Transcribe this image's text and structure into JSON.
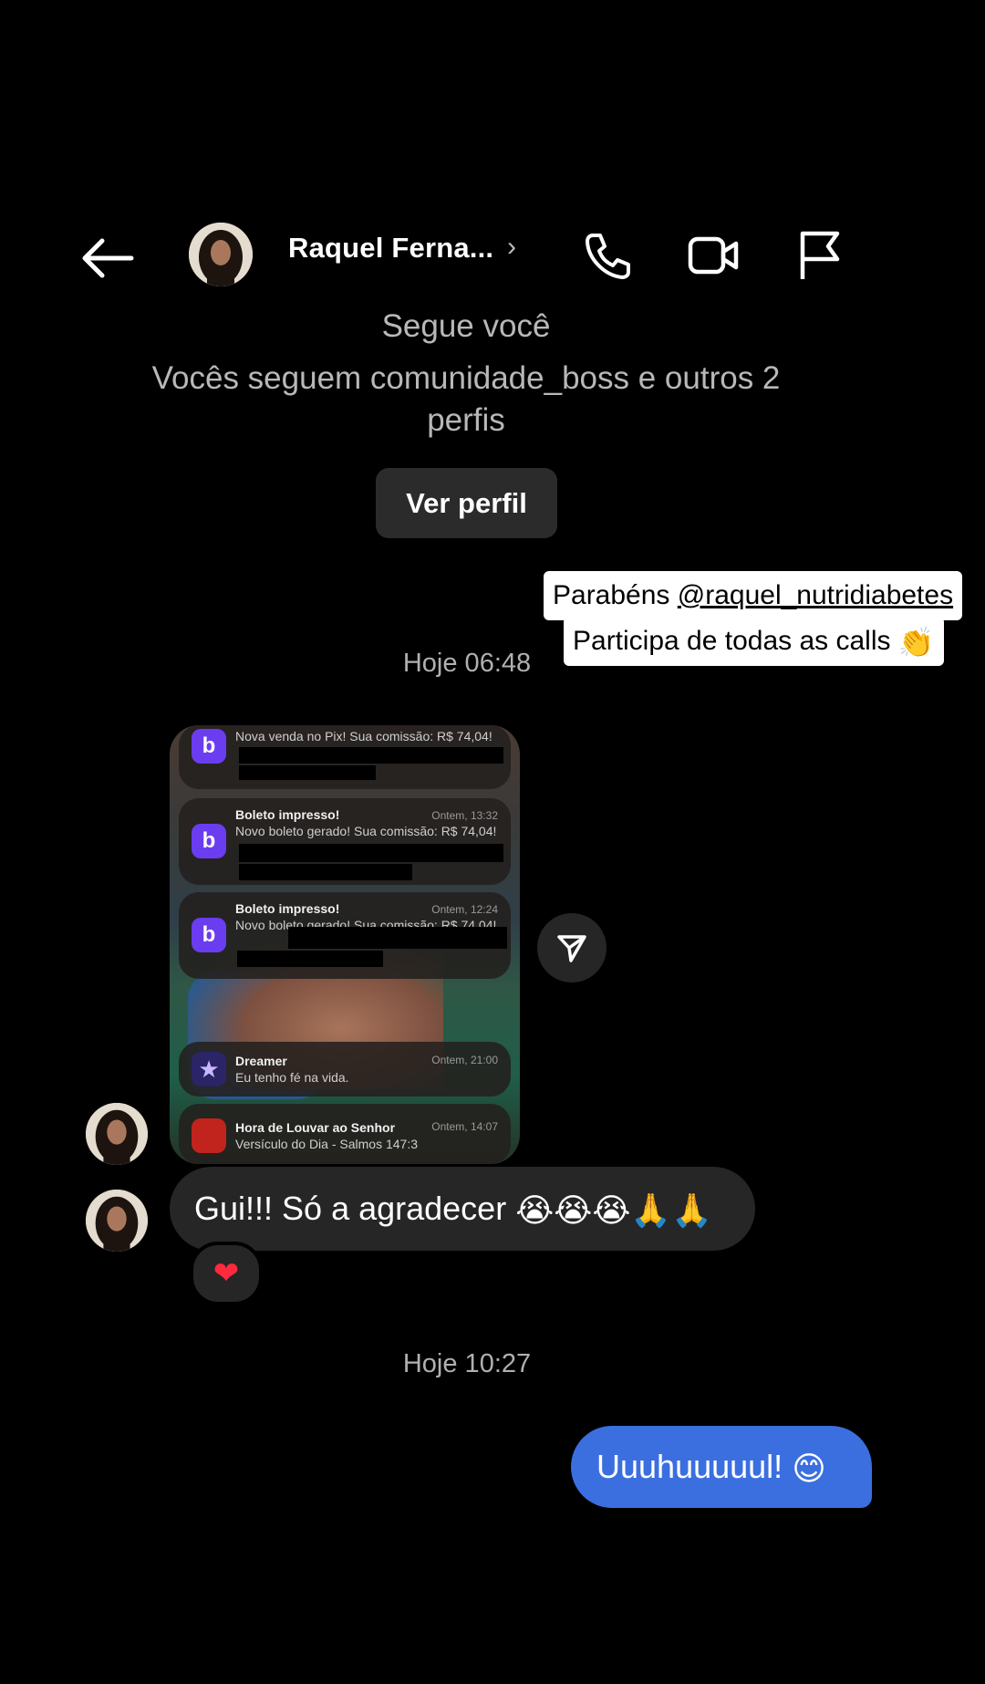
{
  "header": {
    "contact_name": "Raquel Ferna...",
    "chevron": "›",
    "icons": [
      "back-arrow-icon",
      "phone-icon",
      "video-icon",
      "flag-icon"
    ]
  },
  "profile_info": {
    "follows_you": "Segue você",
    "mutual_followers": "Vocês seguem comunidade_boss e outros 2 perfis",
    "view_profile_button": "Ver perfil"
  },
  "story_caption": {
    "line1_prefix": "Parabéns ",
    "line1_mention": "@raquel_nutridiabetes",
    "line2": "Participa de todas as calls"
  },
  "timestamps": {
    "first": "Hoje 06:48",
    "second": "Hoje 10:27"
  },
  "shared_media": {
    "notifications": [
      {
        "app_icon": "b",
        "title": "",
        "time": "",
        "body": "Nova venda no Pix! Sua comissão: R$ 74,04!"
      },
      {
        "app_icon": "b",
        "title": "Boleto impresso!",
        "time": "Ontem, 13:32",
        "body": "Novo boleto gerado! Sua comissão: R$ 74,04!"
      },
      {
        "app_icon": "b",
        "title": "Boleto impresso!",
        "time": "Ontem, 12:24",
        "body": "Novo boleto gerado! Sua comissão: R$ 74,04!"
      },
      {
        "app_icon": "star",
        "title": "Dreamer",
        "time": "Ontem, 21:00",
        "body": "Eu tenho fé na vida."
      },
      {
        "app_icon": "red",
        "title": "Hora de Louvar ao Senhor",
        "time": "Ontem, 14:07",
        "body": "Versículo do Dia - Salmos 147:3"
      }
    ]
  },
  "messages": {
    "incoming_text": "Gui!!! Só a agradecer",
    "incoming_reaction": "heart",
    "outgoing_text": "Uuuhuuuuul!"
  },
  "colors": {
    "background": "#000000",
    "incoming_bubble": "#262626",
    "outgoing_bubble": "#3b6fe0",
    "app_icon_purple": "#6b3df0"
  }
}
